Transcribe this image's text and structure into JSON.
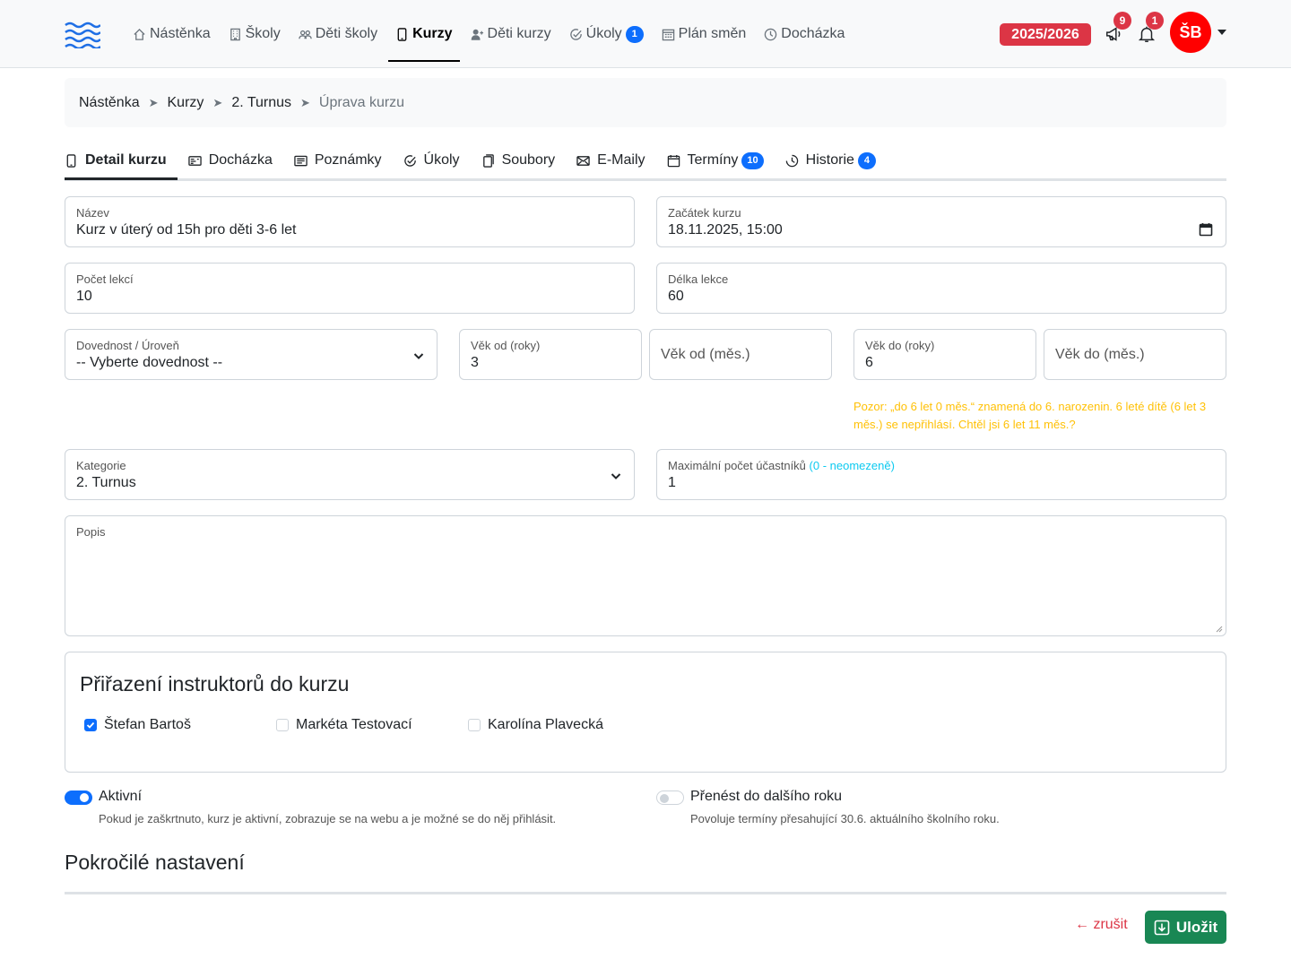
{
  "nav": {
    "items": [
      {
        "label": "Nástěnka",
        "icon": "house-icon"
      },
      {
        "label": "Školy",
        "icon": "building-icon"
      },
      {
        "label": "Děti školy",
        "icon": "people-icon"
      },
      {
        "label": "Kurzy",
        "icon": "tablet-icon",
        "active": true
      },
      {
        "label": "Děti kurzy",
        "icon": "person-plus-icon"
      },
      {
        "label": "Úkoly",
        "icon": "check-circle-icon",
        "badge": "1"
      },
      {
        "label": "Plán směn",
        "icon": "calendar-grid-icon"
      },
      {
        "label": "Docházka",
        "icon": "clock-icon"
      }
    ],
    "school_year": "2025/2026",
    "announcements_count": "9",
    "notifications_count": "1",
    "avatar_initials": "ŠB",
    "colors": {
      "accent": "#0d6efd",
      "danger": "#dc3545",
      "avatar": "#ff0000"
    }
  },
  "breadcrumb": [
    "Nástěnka",
    "Kurzy",
    "2. Turnus",
    "Úprava kurzu"
  ],
  "tabs": [
    {
      "label": "Detail kurzu",
      "icon": "tablet-icon",
      "active": true
    },
    {
      "label": "Docházka",
      "icon": "card-icon"
    },
    {
      "label": "Poznámky",
      "icon": "note-icon"
    },
    {
      "label": "Úkoly",
      "icon": "check-circle-icon"
    },
    {
      "label": "Soubory",
      "icon": "files-icon"
    },
    {
      "label": "E-Maily",
      "icon": "envelope-icon"
    },
    {
      "label": "Termíny",
      "icon": "calendar-icon",
      "badge": "10"
    },
    {
      "label": "Historie",
      "icon": "clock-icon",
      "badge": "4"
    }
  ],
  "form": {
    "name": {
      "label": "Název",
      "value": "Kurz v úterý od 15h pro děti 3-6 let"
    },
    "start": {
      "label": "Začátek kurzu",
      "value": "18.11.2025, 15:00"
    },
    "lessons": {
      "label": "Počet lekcí",
      "value": "10"
    },
    "lesson_length": {
      "label": "Délka lekce",
      "value": "60"
    },
    "skill": {
      "label": "Dovednost / Úroveň",
      "value": "-- Vyberte dovednost --"
    },
    "age_from_years": {
      "label": "Věk od (roky)",
      "value": "3"
    },
    "age_from_months": {
      "placeholder": "Věk od (měs.)"
    },
    "age_to_years": {
      "label": "Věk do (roky)",
      "value": "6"
    },
    "age_to_months": {
      "placeholder": "Věk do (měs.)"
    },
    "age_warning": "Pozor: „do 6 let 0 měs.“ znamená do 6. narozenin. 6 leté dítě (6 let 3 měs.) se nepřihlásí. Chtěl jsi 6 let 11 měs.?",
    "category": {
      "label": "Kategorie",
      "value": "2. Turnus"
    },
    "max_participants": {
      "label": "Maximální počet účastníků",
      "hint": "(0 - neomezeně)",
      "value": "1"
    },
    "description": {
      "label": "Popis",
      "value": ""
    }
  },
  "instructors": {
    "title": "Přiřazení instruktorů do kurzu",
    "list": [
      {
        "name": "Štefan Bartoš",
        "checked": true
      },
      {
        "name": "Markéta Testovací",
        "checked": false
      },
      {
        "name": "Karolína Plavecká",
        "checked": false
      }
    ]
  },
  "switches": {
    "active": {
      "label": "Aktivní",
      "help": "Pokud je zaškrtnuto, kurz je aktivní, zobrazuje se na webu a je možné se do něj přihlásit.",
      "on": true
    },
    "carry_over": {
      "label": "Přenést do dalšího roku",
      "help": "Povoluje termíny přesahující 30.6. aktuálního školního roku.",
      "on": false
    }
  },
  "advanced_title": "Pokročilé nastavení",
  "actions": {
    "cancel": "← zrušit",
    "save": "Uložit"
  }
}
